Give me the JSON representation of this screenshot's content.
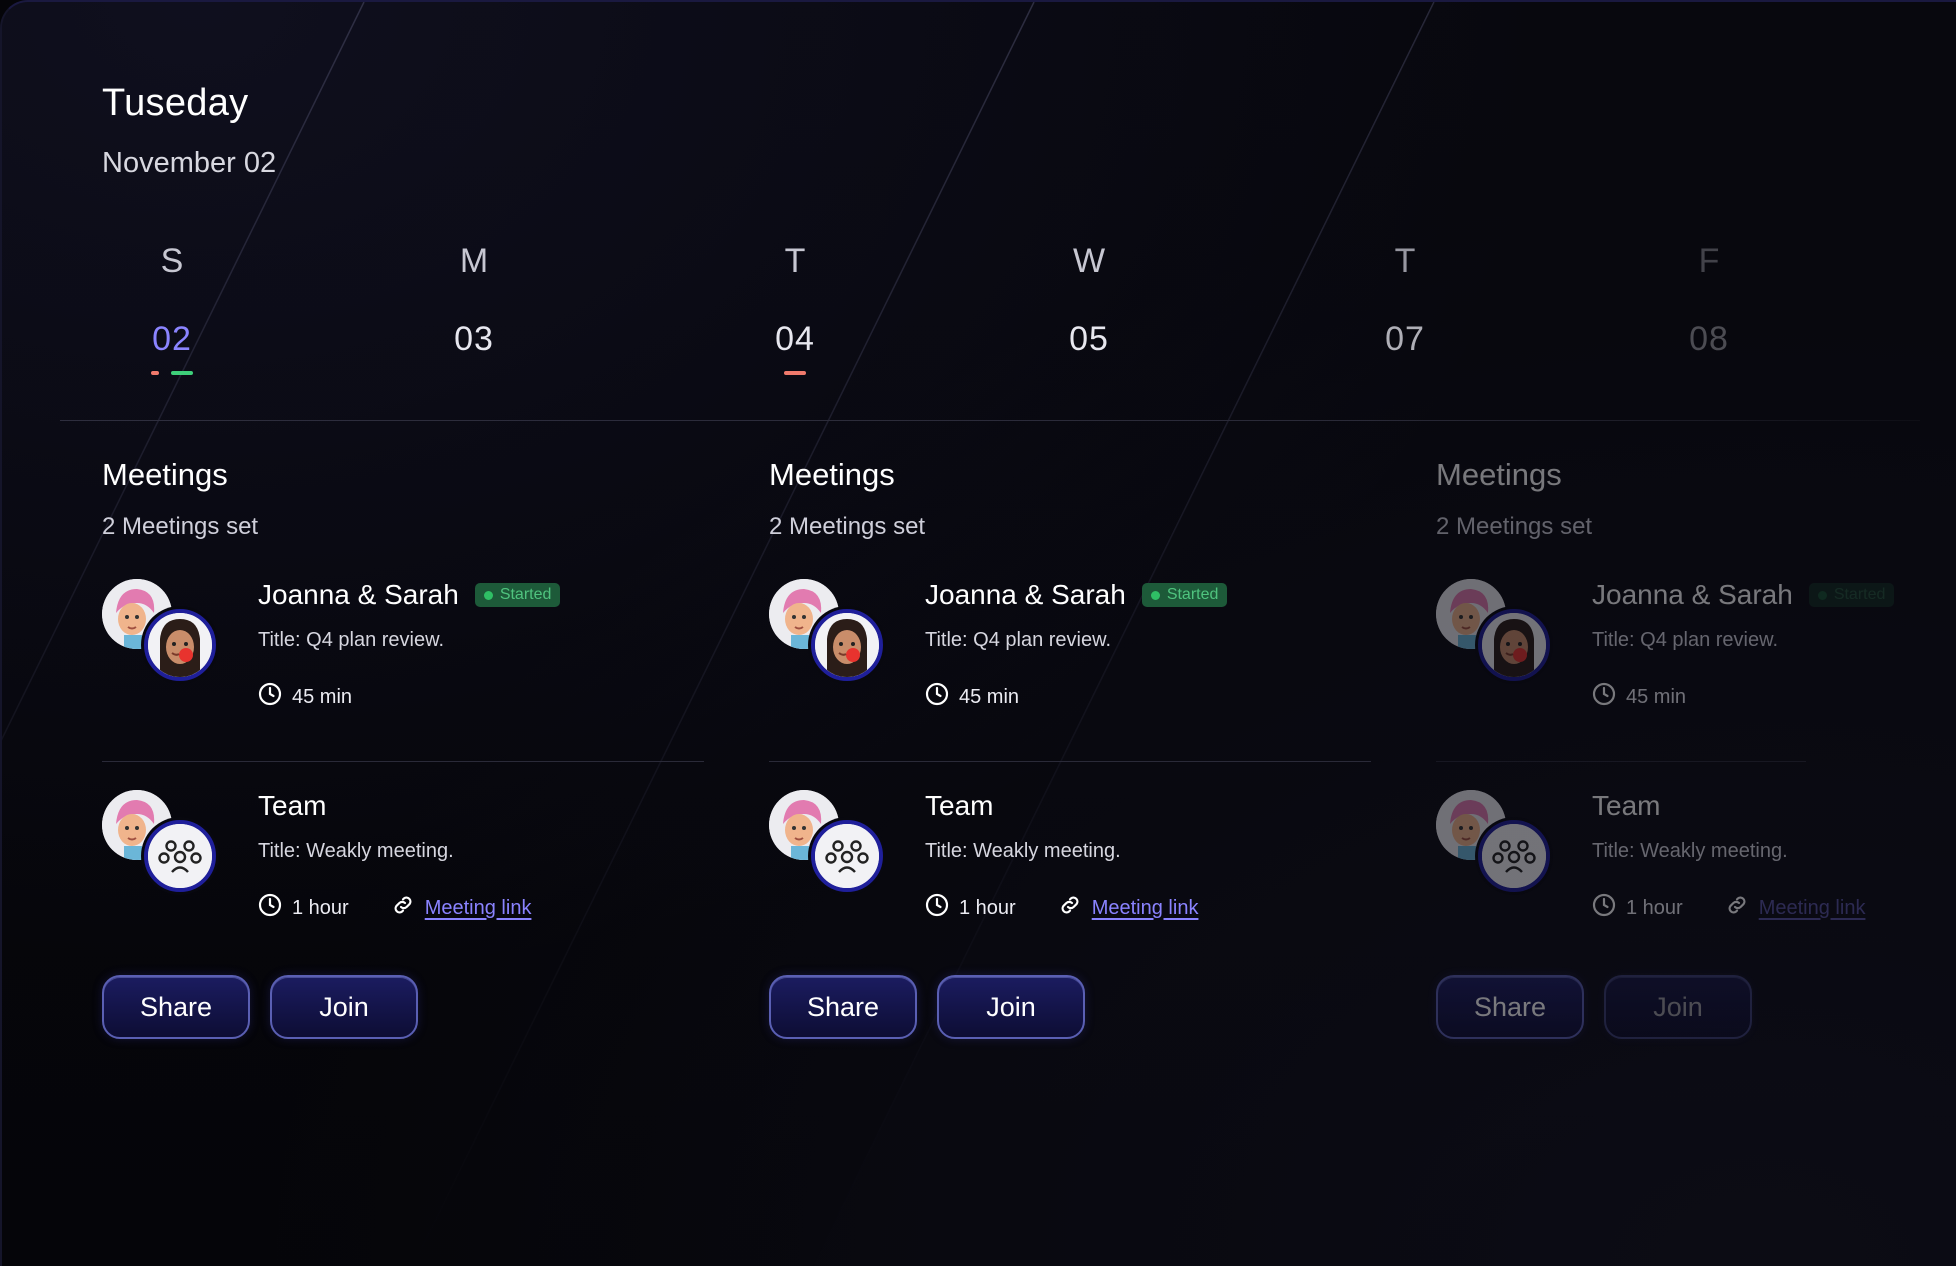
{
  "header": {
    "day": "Tuseday",
    "date": "November 02"
  },
  "week": [
    {
      "letter": "S",
      "num": "02",
      "selected": true,
      "dots": [
        "#f07a6c",
        "#3ecf7a"
      ]
    },
    {
      "letter": "M",
      "num": "03",
      "dots": []
    },
    {
      "letter": "T",
      "num": "04",
      "dots": [
        "#f07a6c"
      ]
    },
    {
      "letter": "W",
      "num": "05",
      "dots": []
    },
    {
      "letter": "T",
      "num": "07",
      "dots": []
    },
    {
      "letter": "F",
      "num": "08",
      "dots": []
    }
  ],
  "columns": [
    {
      "heading": "Meetings",
      "count": "2 Meetings set",
      "meetings": [
        {
          "name": "Joanna & Sarah",
          "badge": "Started",
          "title": "Title: Q4 plan review.",
          "duration": "45 min"
        },
        {
          "name": "Team",
          "title": "Title: Weakly meeting.",
          "duration": "1 hour",
          "link": "Meeting link"
        }
      ],
      "share_label": "Share",
      "join_label": "Join"
    },
    {
      "heading": "Meetings",
      "count": "2 Meetings set",
      "meetings": [
        {
          "name": "Joanna & Sarah",
          "badge": "Started",
          "title": "Title: Q4 plan review.",
          "duration": "45 min"
        },
        {
          "name": "Team",
          "title": "Title: Weakly meeting.",
          "duration": "1 hour",
          "link": "Meeting link"
        }
      ],
      "share_label": "Share",
      "join_label": "Join"
    },
    {
      "heading": "Meetings",
      "count": "2 Meetings set",
      "meetings": [
        {
          "name": "Joanna & Sarah",
          "badge": "Started",
          "title": "Title: Q4 plan review.",
          "duration": "45 min"
        },
        {
          "name": "Team",
          "title": "Title: Weakly meeting.",
          "duration": "1 hour",
          "link": "Meeting link"
        }
      ],
      "share_label": "Share",
      "join_label": "Join"
    }
  ],
  "icons": {
    "clock": "clock-icon",
    "link": "link-icon",
    "group": "group-icon",
    "avatar_pink_hair": "avatar-pink-hair",
    "avatar_dark_hair": "avatar-dark-hair"
  },
  "colors": {
    "accent": "#8a83ff",
    "started_bg": "#1d5a39",
    "started_fg": "#4fc37e",
    "dot_red": "#f07a6c",
    "dot_green": "#3ecf7a",
    "button_border": "#5a5fb3"
  }
}
